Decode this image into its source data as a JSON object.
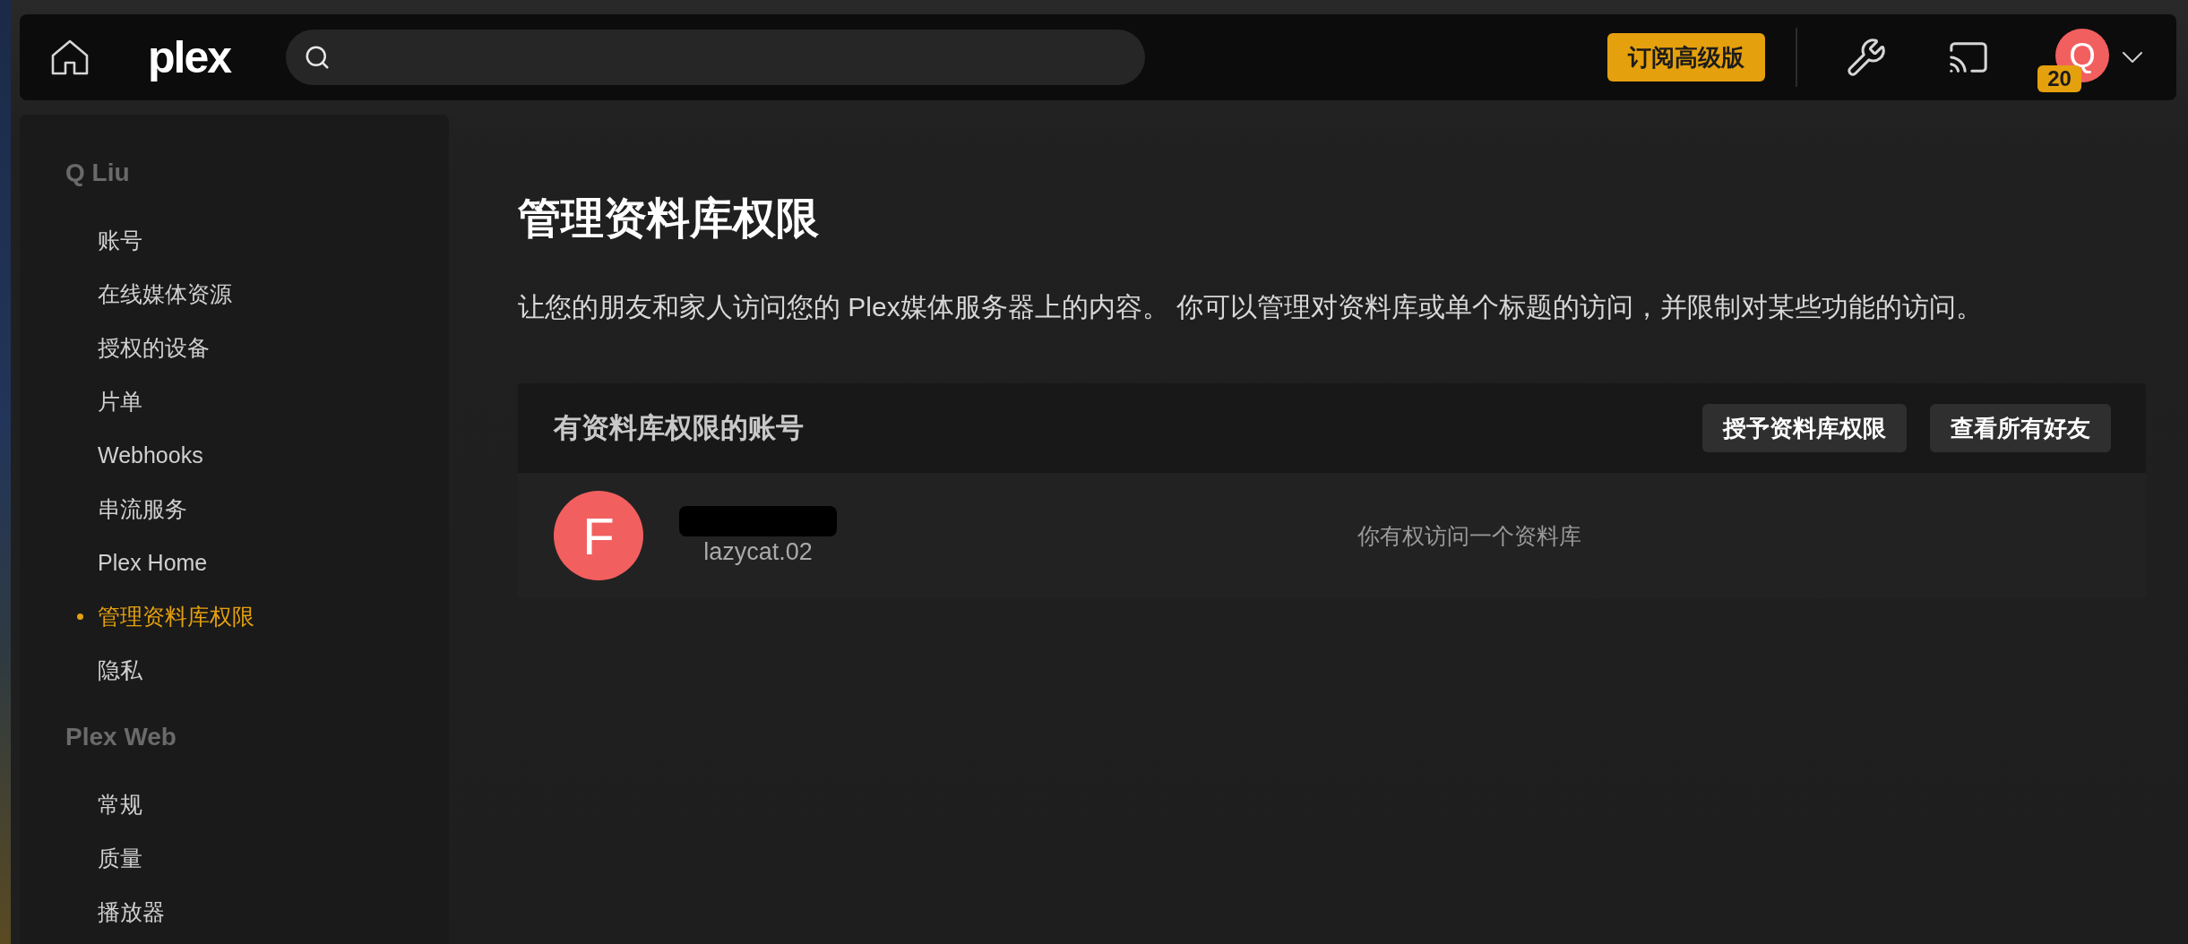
{
  "top_bar": {
    "logo": "plex",
    "subscribe_button": "订阅高级版",
    "account": {
      "initial": "Q",
      "badge": "20"
    }
  },
  "sidebar": {
    "sections": [
      {
        "title": "Q Liu",
        "items": [
          {
            "label": "账号",
            "selected": false
          },
          {
            "label": "在线媒体资源",
            "selected": false
          },
          {
            "label": "授权的设备",
            "selected": false
          },
          {
            "label": "片单",
            "selected": false
          },
          {
            "label": "Webhooks",
            "selected": false
          },
          {
            "label": "串流服务",
            "selected": false
          },
          {
            "label": "Plex Home",
            "selected": false
          },
          {
            "label": "管理资料库权限",
            "selected": true
          },
          {
            "label": "隐私",
            "selected": false
          }
        ]
      },
      {
        "title": "Plex Web",
        "items": [
          {
            "label": "常规",
            "selected": false
          },
          {
            "label": "质量",
            "selected": false
          },
          {
            "label": "播放器",
            "selected": false
          }
        ]
      }
    ]
  },
  "main": {
    "title": "管理资料库权限",
    "description": "让您的朋友和家人访问您的 Plex媒体服务器上的内容。 你可以管理对资料库或单个标题的访问，并限制对某些功能的访问。",
    "accounts_card": {
      "title": "有资料库权限的账号",
      "buttons": [
        "授予资料库权限",
        "查看所有好友"
      ],
      "rows": [
        {
          "initial": "F",
          "name_redacted": true,
          "username": "lazycat.02",
          "access": "你有权访问一个资料库"
        }
      ]
    }
  }
}
